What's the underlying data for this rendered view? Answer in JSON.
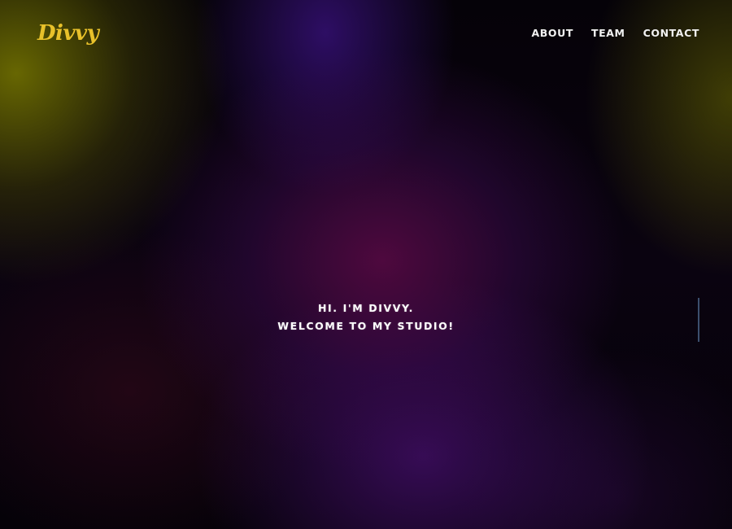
{
  "header": {
    "logo_text": "Divvy",
    "nav": [
      {
        "label": "ABOUT"
      },
      {
        "label": "TEAM"
      },
      {
        "label": "CONTACT"
      }
    ]
  },
  "hero": {
    "line1": "HI. I'M DIVVY.",
    "line2": "WELCOME TO MY STUDIO!"
  },
  "colors": {
    "logo": "#e8c12a",
    "nav_text": "#f2f2f2",
    "hero_text": "#ffffff",
    "scroll_indicator": "#3c4f6e"
  }
}
